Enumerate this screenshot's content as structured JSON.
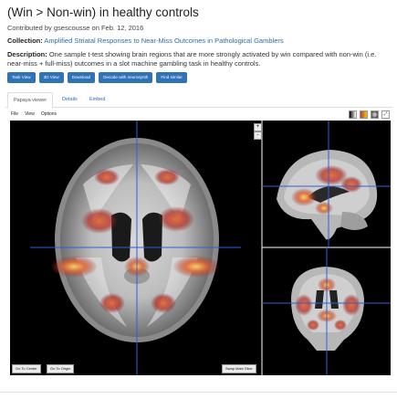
{
  "page": {
    "title": "(Win > Non-win) in healthy controls",
    "contributed": "Contributed by gsescousse on Feb. 12, 2016",
    "collection_label": "Collection:",
    "collection_link": "Amplified Striatal Responses to Near-Miss Outcomes in Pathological Gamblers",
    "description_label": "Description:",
    "description_text": " One sample t-test showing brain regions that are more strongly activated by win compared with non-win (i.e. near-miss + full-miss) outcomes in a slot machine gambling task in healthy controls."
  },
  "buttons": [
    "Task View",
    "3D View",
    "Download",
    "Decode with neurosynth",
    "Find similar"
  ],
  "tabs": [
    "Papaya viewer",
    "Details",
    "Embed"
  ],
  "menu": [
    "File",
    "View",
    "Options"
  ],
  "toolbar_icons": [
    "grayscale-icon",
    "colormap-icon",
    "surface-icon",
    "expand-icon"
  ],
  "viewer": {
    "go_to_center": "Go To Center",
    "go_to_origin": "Go To Origin",
    "swap_main_slice": "Swap Main Slice",
    "zoom_in": "+",
    "zoom_out": "-"
  },
  "colors": {
    "link": "#2a6db0",
    "button": "#2f73b6",
    "crosshair": "#2f5fd6",
    "activation_low": "#c0392b",
    "activation_high": "#f6d56a"
  }
}
